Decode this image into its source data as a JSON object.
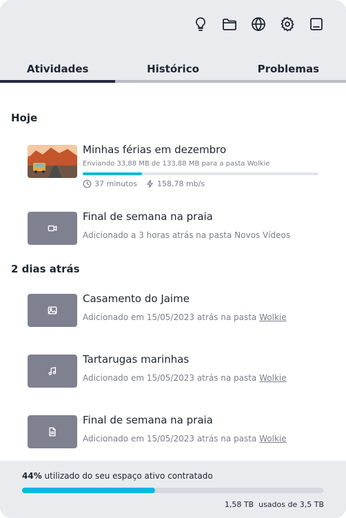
{
  "toolbar": {
    "icons": [
      "lightbulb-icon",
      "folder-icon",
      "globe-icon",
      "gear-icon",
      "panel-icon"
    ]
  },
  "tabs": [
    {
      "label": "Atividades",
      "active": true
    },
    {
      "label": "Histórico",
      "active": false
    },
    {
      "label": "Problemas",
      "active": false
    }
  ],
  "sections": {
    "today": "Hoje",
    "two_days": "2 dias atrás"
  },
  "items": [
    {
      "title": "Minhas férias em dezembro",
      "subtitle": "Enviando 33,88 MB de 133,88 MB para a pasta Wolkie",
      "progress": 0.25,
      "time_left": "37 minutos",
      "speed": "158,78 mb/s",
      "thumb": "photo"
    },
    {
      "title": "Final de semana na praia",
      "subtitle": "Adicionado a 3 horas atrás na pasta Novos Vídeos",
      "thumb": "video-icon"
    },
    {
      "title": "Casamento do Jaime",
      "subtitle_prefix": "Adicionado em 15/05/2023 atrás na pasta ",
      "folder": "Wolkie",
      "thumb": "image-icon"
    },
    {
      "title": "Tartarugas marinhas",
      "subtitle_prefix": "Adicionado em 15/05/2023 atrás na pasta ",
      "folder": "Wolkie",
      "thumb": "music-icon"
    },
    {
      "title": "Final de semana na praia",
      "subtitle_prefix": "Adicionado em 15/05/2023 atrás na pasta ",
      "folder": "Wolkie",
      "thumb": "document-icon"
    }
  ],
  "storage": {
    "percent_label": "44%",
    "text": " utilizado do seu espaço ativo contratado",
    "fraction": 0.44,
    "used": "1,58 TB",
    "detail": "  usados de 3,5 TB"
  },
  "colors": {
    "accent": "#0bb6e0",
    "tab_active": "#232a3d",
    "thumb_bg": "#7f8090"
  }
}
